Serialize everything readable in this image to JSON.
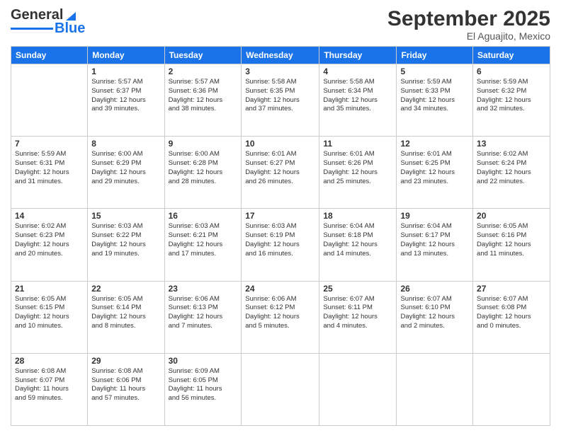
{
  "header": {
    "logo_text1": "General",
    "logo_text2": "Blue",
    "month": "September 2025",
    "location": "El Aguajito, Mexico"
  },
  "days_of_week": [
    "Sunday",
    "Monday",
    "Tuesday",
    "Wednesday",
    "Thursday",
    "Friday",
    "Saturday"
  ],
  "weeks": [
    [
      {
        "day": "",
        "info": ""
      },
      {
        "day": "1",
        "info": "Sunrise: 5:57 AM\nSunset: 6:37 PM\nDaylight: 12 hours\nand 39 minutes."
      },
      {
        "day": "2",
        "info": "Sunrise: 5:57 AM\nSunset: 6:36 PM\nDaylight: 12 hours\nand 38 minutes."
      },
      {
        "day": "3",
        "info": "Sunrise: 5:58 AM\nSunset: 6:35 PM\nDaylight: 12 hours\nand 37 minutes."
      },
      {
        "day": "4",
        "info": "Sunrise: 5:58 AM\nSunset: 6:34 PM\nDaylight: 12 hours\nand 35 minutes."
      },
      {
        "day": "5",
        "info": "Sunrise: 5:59 AM\nSunset: 6:33 PM\nDaylight: 12 hours\nand 34 minutes."
      },
      {
        "day": "6",
        "info": "Sunrise: 5:59 AM\nSunset: 6:32 PM\nDaylight: 12 hours\nand 32 minutes."
      }
    ],
    [
      {
        "day": "7",
        "info": "Sunrise: 5:59 AM\nSunset: 6:31 PM\nDaylight: 12 hours\nand 31 minutes."
      },
      {
        "day": "8",
        "info": "Sunrise: 6:00 AM\nSunset: 6:29 PM\nDaylight: 12 hours\nand 29 minutes."
      },
      {
        "day": "9",
        "info": "Sunrise: 6:00 AM\nSunset: 6:28 PM\nDaylight: 12 hours\nand 28 minutes."
      },
      {
        "day": "10",
        "info": "Sunrise: 6:01 AM\nSunset: 6:27 PM\nDaylight: 12 hours\nand 26 minutes."
      },
      {
        "day": "11",
        "info": "Sunrise: 6:01 AM\nSunset: 6:26 PM\nDaylight: 12 hours\nand 25 minutes."
      },
      {
        "day": "12",
        "info": "Sunrise: 6:01 AM\nSunset: 6:25 PM\nDaylight: 12 hours\nand 23 minutes."
      },
      {
        "day": "13",
        "info": "Sunrise: 6:02 AM\nSunset: 6:24 PM\nDaylight: 12 hours\nand 22 minutes."
      }
    ],
    [
      {
        "day": "14",
        "info": "Sunrise: 6:02 AM\nSunset: 6:23 PM\nDaylight: 12 hours\nand 20 minutes."
      },
      {
        "day": "15",
        "info": "Sunrise: 6:03 AM\nSunset: 6:22 PM\nDaylight: 12 hours\nand 19 minutes."
      },
      {
        "day": "16",
        "info": "Sunrise: 6:03 AM\nSunset: 6:21 PM\nDaylight: 12 hours\nand 17 minutes."
      },
      {
        "day": "17",
        "info": "Sunrise: 6:03 AM\nSunset: 6:19 PM\nDaylight: 12 hours\nand 16 minutes."
      },
      {
        "day": "18",
        "info": "Sunrise: 6:04 AM\nSunset: 6:18 PM\nDaylight: 12 hours\nand 14 minutes."
      },
      {
        "day": "19",
        "info": "Sunrise: 6:04 AM\nSunset: 6:17 PM\nDaylight: 12 hours\nand 13 minutes."
      },
      {
        "day": "20",
        "info": "Sunrise: 6:05 AM\nSunset: 6:16 PM\nDaylight: 12 hours\nand 11 minutes."
      }
    ],
    [
      {
        "day": "21",
        "info": "Sunrise: 6:05 AM\nSunset: 6:15 PM\nDaylight: 12 hours\nand 10 minutes."
      },
      {
        "day": "22",
        "info": "Sunrise: 6:05 AM\nSunset: 6:14 PM\nDaylight: 12 hours\nand 8 minutes."
      },
      {
        "day": "23",
        "info": "Sunrise: 6:06 AM\nSunset: 6:13 PM\nDaylight: 12 hours\nand 7 minutes."
      },
      {
        "day": "24",
        "info": "Sunrise: 6:06 AM\nSunset: 6:12 PM\nDaylight: 12 hours\nand 5 minutes."
      },
      {
        "day": "25",
        "info": "Sunrise: 6:07 AM\nSunset: 6:11 PM\nDaylight: 12 hours\nand 4 minutes."
      },
      {
        "day": "26",
        "info": "Sunrise: 6:07 AM\nSunset: 6:10 PM\nDaylight: 12 hours\nand 2 minutes."
      },
      {
        "day": "27",
        "info": "Sunrise: 6:07 AM\nSunset: 6:08 PM\nDaylight: 12 hours\nand 0 minutes."
      }
    ],
    [
      {
        "day": "28",
        "info": "Sunrise: 6:08 AM\nSunset: 6:07 PM\nDaylight: 11 hours\nand 59 minutes."
      },
      {
        "day": "29",
        "info": "Sunrise: 6:08 AM\nSunset: 6:06 PM\nDaylight: 11 hours\nand 57 minutes."
      },
      {
        "day": "30",
        "info": "Sunrise: 6:09 AM\nSunset: 6:05 PM\nDaylight: 11 hours\nand 56 minutes."
      },
      {
        "day": "",
        "info": ""
      },
      {
        "day": "",
        "info": ""
      },
      {
        "day": "",
        "info": ""
      },
      {
        "day": "",
        "info": ""
      }
    ]
  ]
}
